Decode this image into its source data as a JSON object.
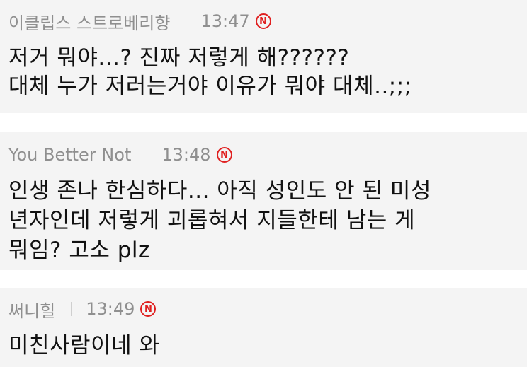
{
  "comments": [
    {
      "nickname": "이클립스 스트로베리향",
      "time": "13:47",
      "badge": "N",
      "text": "저거 뭐야...? 진짜 저렇게 해??????\n대체 누가 저러는거야 이유가 뭐야 대체..;;;"
    },
    {
      "nickname": "You Better Not",
      "time": "13:48",
      "badge": "N",
      "text": "인생 존나 한심하다... 아직 성인도 안 된 미성\n년자인데 저렇게 괴롭혀서 지들한테 남는 게\n뭐임? 고소 plz"
    },
    {
      "nickname": "써니힐",
      "time": "13:49",
      "badge": "N",
      "text": "미친사람이네 와"
    }
  ],
  "colors": {
    "comment_bg": "#f4f4f4",
    "meta_text": "#8f8f8f",
    "body_text": "#111111",
    "new_badge": "#e02020"
  }
}
